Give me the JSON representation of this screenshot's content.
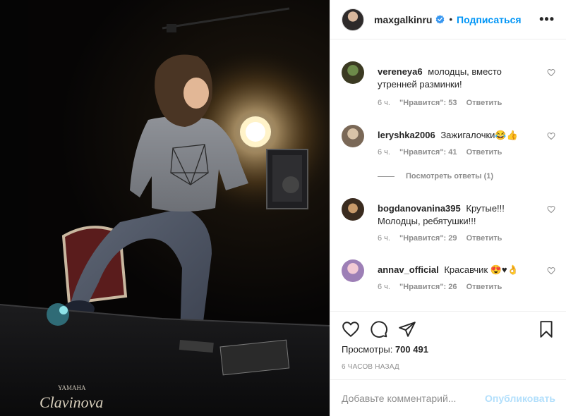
{
  "header": {
    "username": "maxgalkinru",
    "follow_label": "Подписаться",
    "more_icon": "more-options-icon"
  },
  "media": {
    "piano_brand": "YAMAHA",
    "piano_model": "Clavinova"
  },
  "comments": [
    {
      "username": "vereneya6",
      "text": "молодцы, вместо утренней разминки!",
      "time": "6 ч.",
      "likes": "\"Нравится\": 53",
      "reply": "Ответить"
    },
    {
      "username": "leryshka2006",
      "text": "Зажигалочки😂👍",
      "time": "6 ч.",
      "likes": "\"Нравится\": 41",
      "reply": "Ответить",
      "view_replies": "Посмотреть ответы (1)"
    },
    {
      "username": "bogdanovanina395",
      "text": "Крутые!!! Молодцы, ребятушки!!!",
      "time": "6 ч.",
      "likes": "\"Нравится\": 29",
      "reply": "Ответить"
    },
    {
      "username": "annav_official",
      "text": "Красавчик 😍♥👌",
      "time": "6 ч.",
      "likes": "\"Нравится\": 26",
      "reply": "Ответить"
    }
  ],
  "stats": {
    "views_label": "Просмотры:",
    "views_count": "700 491",
    "time_ago": "6 ЧАСОВ НАЗАД"
  },
  "composer": {
    "placeholder": "Добавьте комментарий...",
    "publish_label": "Опубликовать"
  },
  "colors": {
    "accent": "#0095f6",
    "publish_disabled": "#b2dffc",
    "muted": "#8e8e8e",
    "border": "#efefef"
  }
}
